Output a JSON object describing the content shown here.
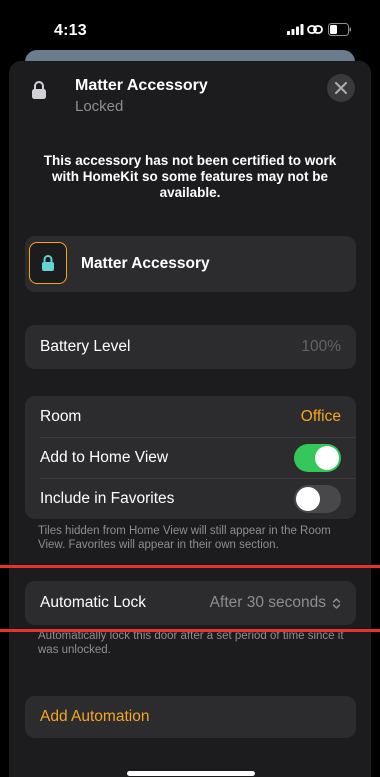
{
  "status_bar": {
    "time": "4:13"
  },
  "header": {
    "title": "Matter Accessory",
    "subtitle": "Locked",
    "icon": "lock-icon",
    "close_icon": "close-icon"
  },
  "warning": "This accessory has not been certified to work with HomeKit so some features may not be available.",
  "accessory_tile": {
    "name": "Matter Accessory",
    "icon": "lock-icon",
    "accent_color": "#f6a623",
    "icon_color": "#5fd6d0"
  },
  "battery": {
    "label": "Battery Level",
    "value": "100%"
  },
  "settings": {
    "room_label": "Room",
    "room_value": "Office",
    "home_view_label": "Add to Home View",
    "home_view_on": true,
    "favorites_label": "Include in Favorites",
    "favorites_on": false,
    "footnote": "Tiles hidden from Home View will still appear in the Room View. Favorites will appear in their own section."
  },
  "automatic_lock": {
    "label": "Automatic Lock",
    "value": "After 30 seconds",
    "footnote": "Automatically lock this door after a set period of time since it was unlocked."
  },
  "automation": {
    "label": "Add Automation"
  },
  "colors": {
    "accent": "#f6a623",
    "toggle_on": "#34c759",
    "highlight_line": "#e3342f",
    "background": "#1c1c1e",
    "card": "#2c2c2e"
  }
}
